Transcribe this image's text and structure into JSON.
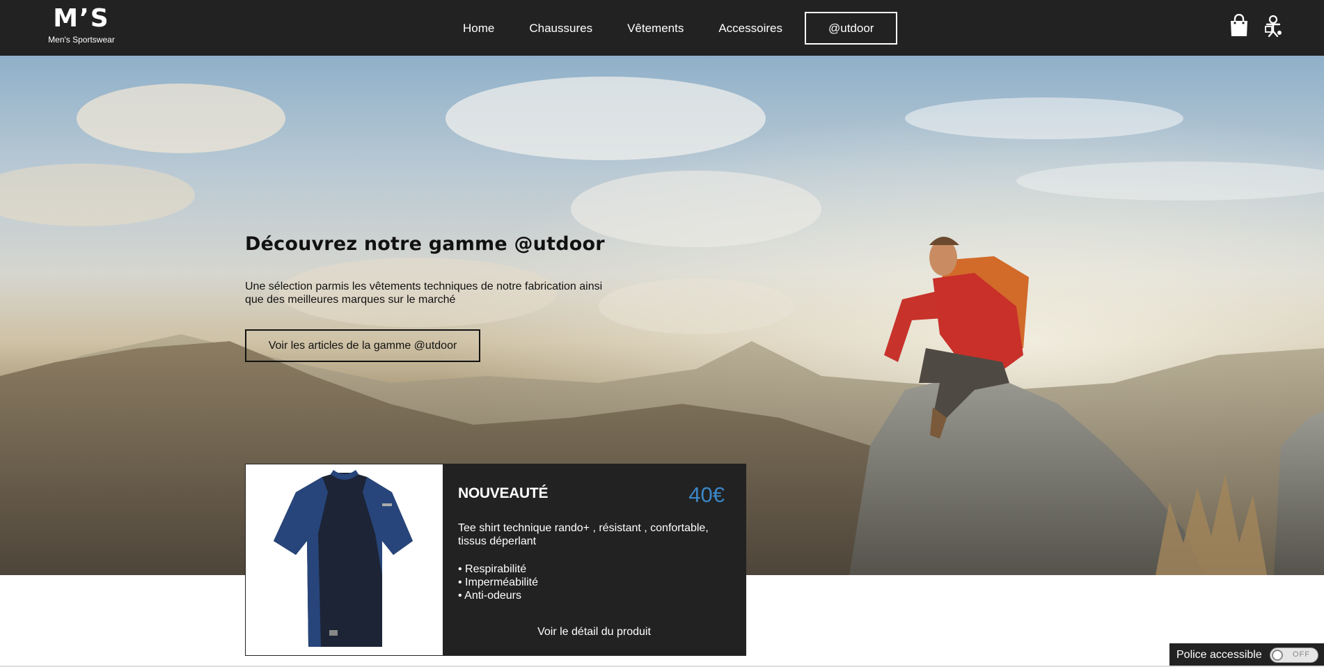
{
  "brand": {
    "logo_mark": "M’S",
    "logo_subtitle": "Men's Sportswear"
  },
  "nav": {
    "items": [
      {
        "label": "Home"
      },
      {
        "label": "Chaussures"
      },
      {
        "label": "Vêtements"
      },
      {
        "label": "Accessoires"
      },
      {
        "label": "@utdoor",
        "active": true
      }
    ]
  },
  "header_icons": [
    "shopping-bag-icon",
    "accessibility-person-icon"
  ],
  "hero": {
    "title": "Découvrez notre gamme @utdoor",
    "text": "Une sélection parmis les vêtements techniques de notre fabrication ainsi que des meilleures marques sur le marché",
    "button_label": "Voir les articles de la gamme @utdoor"
  },
  "product_card": {
    "tag": "NOUVEAUTÉ",
    "price": "40€",
    "price_color": "#3a87c8",
    "description": "Tee shirt technique rando+ , résistant , confortable, tissus déperlant",
    "features": [
      "• Respirabilité",
      "• Imperméabilité",
      "• Anti-odeurs"
    ],
    "link_label": "Voir le détail du produit"
  },
  "accessibility": {
    "label": "Police accessible",
    "toggle_state": "OFF"
  },
  "colors": {
    "header_bg": "#222222",
    "card_bg": "#222222",
    "accent": "#3a87c8"
  }
}
